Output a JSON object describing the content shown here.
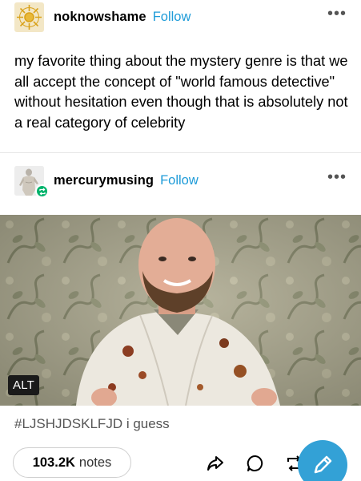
{
  "posts": [
    {
      "username": "noknowshame",
      "follow_label": "Follow",
      "more_label": "•••",
      "text": "my favorite thing about the mystery genre is that we all accept the concept of \"world famous detective\" without hesitation even though that is absolutely not a real category of celebrity"
    },
    {
      "username": "mercurymusing",
      "follow_label": "Follow",
      "more_label": "•••",
      "image_alt_badge": "ALT",
      "tags": "#LJSHJDSKLFJD i guess"
    }
  ],
  "footer": {
    "notes_count": "103.2K",
    "notes_label": "notes"
  },
  "icons": {
    "share": "share-icon",
    "reply": "reply-icon",
    "reblog": "reblog-icon",
    "compose": "pencil-icon"
  },
  "colors": {
    "follow": "#1d9bd8",
    "fab": "#33a1d6",
    "reblog_badge": "#00b36b"
  }
}
